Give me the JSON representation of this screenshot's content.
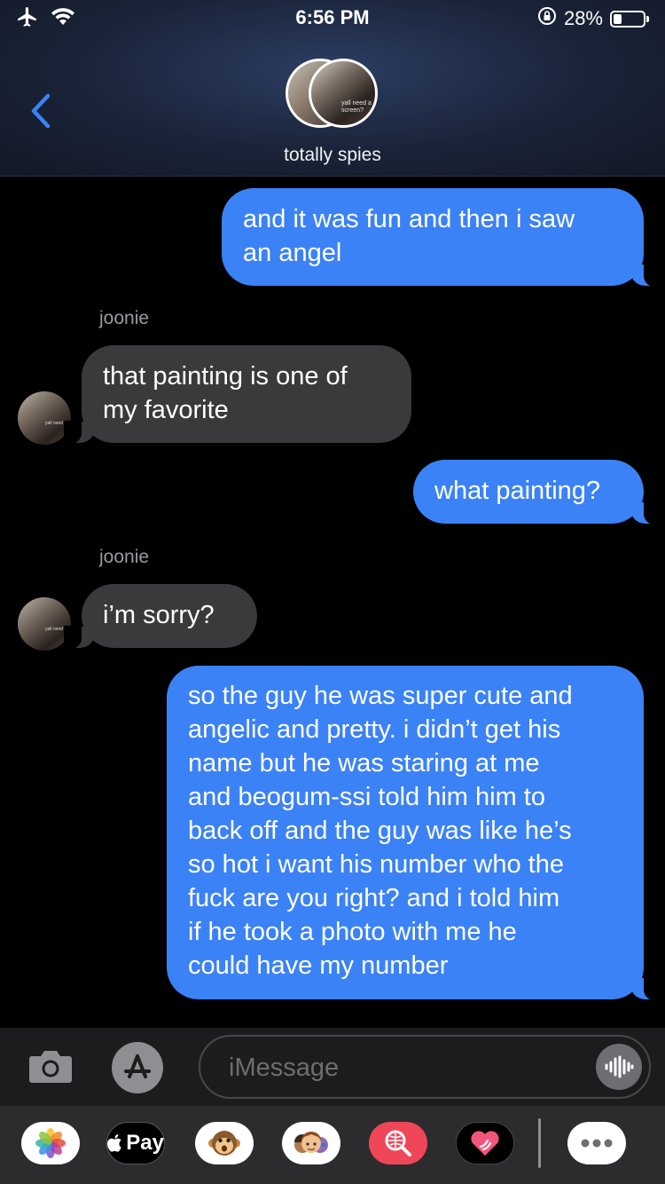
{
  "status_bar": {
    "time": "6:56 PM",
    "battery_text": "28%",
    "battery_level": 0.28
  },
  "header": {
    "group_name": "totally spies",
    "avatar_caption_1": "yall need a",
    "avatar_caption_2": "screen?",
    "icons": [
      "airplane-icon",
      "wifi-icon",
      "orientation-lock-icon",
      "battery-icon",
      "chevron-left-icon"
    ]
  },
  "messages": [
    {
      "direction": "outgoing",
      "text_lines": [
        "and it was fun and then i saw",
        "an angel"
      ]
    },
    {
      "direction": "incoming",
      "sender": "joonie",
      "text_lines": [
        "that painting is one of",
        "my favorite"
      ]
    },
    {
      "direction": "outgoing",
      "text_lines": [
        "what painting?"
      ]
    },
    {
      "direction": "incoming",
      "sender": "joonie",
      "text_lines": [
        "i’m sorry?"
      ]
    },
    {
      "direction": "outgoing",
      "text_lines": [
        "so the guy he was super cute and",
        "angelic and pretty. i didn’t get his",
        "name but he was staring at me",
        "and beogum-ssi told him him to",
        "back off and the guy was like he’s",
        "so hot i want his number who the",
        "fuck are you right? and i told him",
        "if he took a photo with me he",
        "could have my number"
      ]
    }
  ],
  "input": {
    "placeholder": "iMessage",
    "value": ""
  },
  "app_drawer": {
    "apple_pay_label": "Pay",
    "icons": [
      "photos-icon",
      "apple-pay-icon",
      "animoji-icon",
      "memoji-icon",
      "image-search-icon",
      "digital-touch-icon",
      "more-icon"
    ]
  },
  "colors": {
    "outgoing_bubble": "#3b82f6",
    "incoming_bubble": "#3a3a3c",
    "accent": "#3b82f6"
  }
}
